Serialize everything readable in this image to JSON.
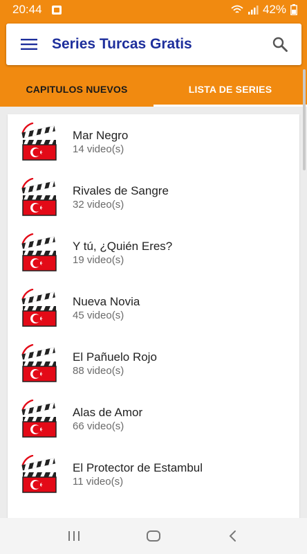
{
  "status_bar": {
    "time": "20:44",
    "battery": "42%",
    "icons": [
      "notification-icon",
      "wifi-icon",
      "signal-icon",
      "battery-icon"
    ]
  },
  "toolbar": {
    "title": "Series Turcas Gratis",
    "menu_icon": "hamburger-menu-icon",
    "search_icon": "search-icon"
  },
  "tabs": [
    {
      "label": "CAPITULOS NUEVOS",
      "active": false
    },
    {
      "label": "LISTA DE SERIES",
      "active": true
    }
  ],
  "series": [
    {
      "name": "Mar Negro",
      "count": "14 video(s)"
    },
    {
      "name": "Rivales de Sangre",
      "count": "32 video(s)"
    },
    {
      "name": "Y tú, ¿Quién Eres?",
      "count": "19 video(s)"
    },
    {
      "name": "Nueva Novia",
      "count": "45 video(s)"
    },
    {
      "name": "El Pañuelo Rojo",
      "count": "88 video(s)"
    },
    {
      "name": "Alas de Amor",
      "count": "66 video(s)"
    },
    {
      "name": "El Protector de Estambul",
      "count": "11 video(s)"
    }
  ],
  "nav_bar": {
    "icons": [
      "recent-apps-icon",
      "home-icon",
      "back-icon"
    ]
  },
  "colors": {
    "accent": "#f18a10",
    "title": "#1e2f9c",
    "flag_red": "#e30a17"
  }
}
